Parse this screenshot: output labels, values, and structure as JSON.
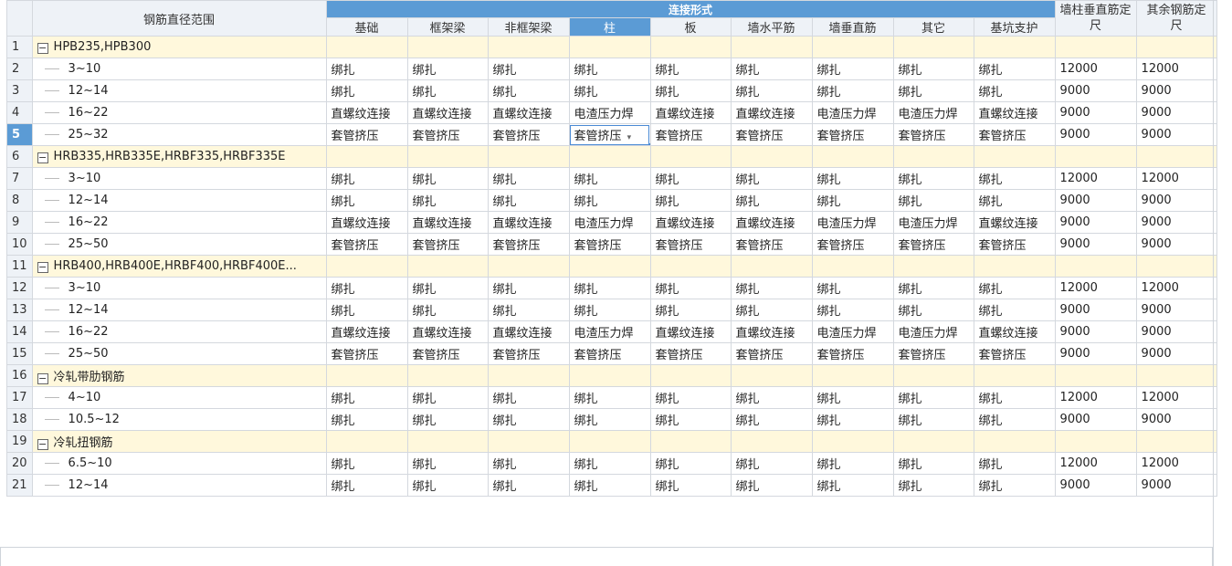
{
  "header": {
    "range_label": "钢筋直径范围",
    "group_label": "连接形式",
    "columns": [
      "基础",
      "框架梁",
      "非框架梁",
      "柱",
      "板",
      "墙水平筋",
      "墙垂直筋",
      "其它",
      "基坑支护"
    ],
    "wall_col_label": "墙柱垂直筋定尺",
    "other_col_label": "其余钢筋定尺"
  },
  "selected": {
    "row": 5,
    "column": "柱"
  },
  "rows": [
    {
      "n": "1",
      "group": true,
      "label": "HPB235,HPB300"
    },
    {
      "n": "2",
      "label": "3~10",
      "cells": [
        "绑扎",
        "绑扎",
        "绑扎",
        "绑扎",
        "绑扎",
        "绑扎",
        "绑扎",
        "绑扎",
        "绑扎"
      ],
      "wall": "12000",
      "other": "12000"
    },
    {
      "n": "3",
      "label": "12~14",
      "cells": [
        "绑扎",
        "绑扎",
        "绑扎",
        "绑扎",
        "绑扎",
        "绑扎",
        "绑扎",
        "绑扎",
        "绑扎"
      ],
      "wall": "9000",
      "other": "9000"
    },
    {
      "n": "4",
      "label": "16~22",
      "cells": [
        "直螺纹连接",
        "直螺纹连接",
        "直螺纹连接",
        "电渣压力焊",
        "直螺纹连接",
        "直螺纹连接",
        "电渣压力焊",
        "电渣压力焊",
        "直螺纹连接"
      ],
      "wall": "9000",
      "other": "9000"
    },
    {
      "n": "5",
      "label": "25~32",
      "cells": [
        "套管挤压",
        "套管挤压",
        "套管挤压",
        "套管挤压",
        "套管挤压",
        "套管挤压",
        "套管挤压",
        "套管挤压",
        "套管挤压"
      ],
      "wall": "9000",
      "other": "9000"
    },
    {
      "n": "6",
      "group": true,
      "label": "HRB335,HRB335E,HRBF335,HRBF335E"
    },
    {
      "n": "7",
      "label": "3~10",
      "cells": [
        "绑扎",
        "绑扎",
        "绑扎",
        "绑扎",
        "绑扎",
        "绑扎",
        "绑扎",
        "绑扎",
        "绑扎"
      ],
      "wall": "12000",
      "other": "12000"
    },
    {
      "n": "8",
      "label": "12~14",
      "cells": [
        "绑扎",
        "绑扎",
        "绑扎",
        "绑扎",
        "绑扎",
        "绑扎",
        "绑扎",
        "绑扎",
        "绑扎"
      ],
      "wall": "9000",
      "other": "9000"
    },
    {
      "n": "9",
      "label": "16~22",
      "cells": [
        "直螺纹连接",
        "直螺纹连接",
        "直螺纹连接",
        "电渣压力焊",
        "直螺纹连接",
        "直螺纹连接",
        "电渣压力焊",
        "电渣压力焊",
        "直螺纹连接"
      ],
      "wall": "9000",
      "other": "9000"
    },
    {
      "n": "10",
      "label": "25~50",
      "cells": [
        "套管挤压",
        "套管挤压",
        "套管挤压",
        "套管挤压",
        "套管挤压",
        "套管挤压",
        "套管挤压",
        "套管挤压",
        "套管挤压"
      ],
      "wall": "9000",
      "other": "9000"
    },
    {
      "n": "11",
      "group": true,
      "label": "HRB400,HRB400E,HRBF400,HRBF400E..."
    },
    {
      "n": "12",
      "label": "3~10",
      "cells": [
        "绑扎",
        "绑扎",
        "绑扎",
        "绑扎",
        "绑扎",
        "绑扎",
        "绑扎",
        "绑扎",
        "绑扎"
      ],
      "wall": "12000",
      "other": "12000"
    },
    {
      "n": "13",
      "label": "12~14",
      "cells": [
        "绑扎",
        "绑扎",
        "绑扎",
        "绑扎",
        "绑扎",
        "绑扎",
        "绑扎",
        "绑扎",
        "绑扎"
      ],
      "wall": "9000",
      "other": "9000"
    },
    {
      "n": "14",
      "label": "16~22",
      "cells": [
        "直螺纹连接",
        "直螺纹连接",
        "直螺纹连接",
        "电渣压力焊",
        "直螺纹连接",
        "直螺纹连接",
        "电渣压力焊",
        "电渣压力焊",
        "直螺纹连接"
      ],
      "wall": "9000",
      "other": "9000"
    },
    {
      "n": "15",
      "label": "25~50",
      "cells": [
        "套管挤压",
        "套管挤压",
        "套管挤压",
        "套管挤压",
        "套管挤压",
        "套管挤压",
        "套管挤压",
        "套管挤压",
        "套管挤压"
      ],
      "wall": "9000",
      "other": "9000"
    },
    {
      "n": "16",
      "group": true,
      "label": "冷轧带肋钢筋"
    },
    {
      "n": "17",
      "label": "4~10",
      "cells": [
        "绑扎",
        "绑扎",
        "绑扎",
        "绑扎",
        "绑扎",
        "绑扎",
        "绑扎",
        "绑扎",
        "绑扎"
      ],
      "wall": "12000",
      "other": "12000"
    },
    {
      "n": "18",
      "label": "10.5~12",
      "cells": [
        "绑扎",
        "绑扎",
        "绑扎",
        "绑扎",
        "绑扎",
        "绑扎",
        "绑扎",
        "绑扎",
        "绑扎"
      ],
      "wall": "9000",
      "other": "9000"
    },
    {
      "n": "19",
      "group": true,
      "label": "冷轧扭钢筋"
    },
    {
      "n": "20",
      "label": "6.5~10",
      "cells": [
        "绑扎",
        "绑扎",
        "绑扎",
        "绑扎",
        "绑扎",
        "绑扎",
        "绑扎",
        "绑扎",
        "绑扎"
      ],
      "wall": "12000",
      "other": "12000"
    },
    {
      "n": "21",
      "label": "12~14",
      "cells": [
        "绑扎",
        "绑扎",
        "绑扎",
        "绑扎",
        "绑扎",
        "绑扎",
        "绑扎",
        "绑扎",
        "绑扎"
      ],
      "wall": "9000",
      "other": "9000"
    }
  ],
  "icons": {
    "collapse": "minus-box-icon",
    "dropdown": "caret-down-icon"
  },
  "colors": {
    "header_selected": "#5b9bd5",
    "group_row": "#fff8dc",
    "header_bg": "#eef2f7"
  }
}
